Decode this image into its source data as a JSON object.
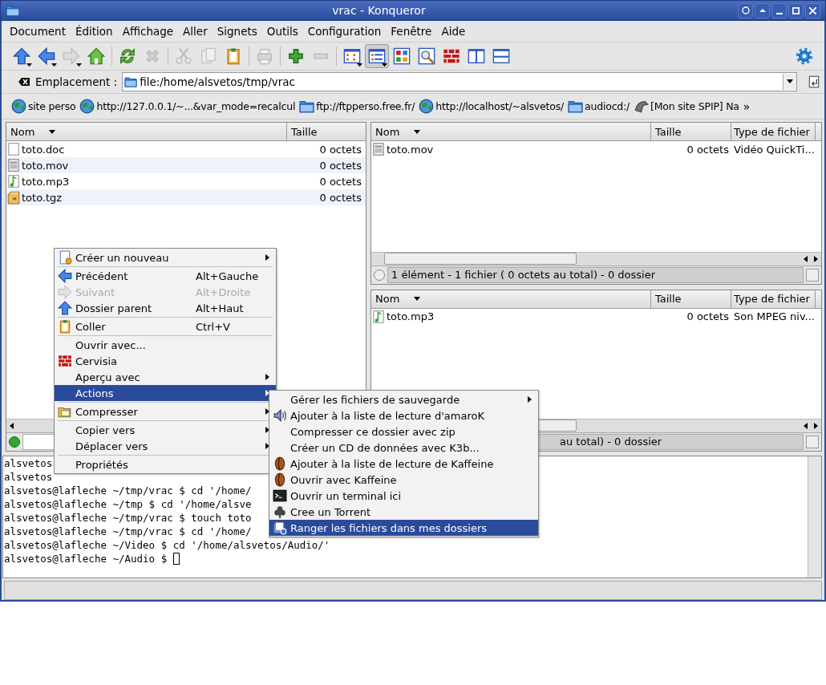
{
  "window": {
    "title": "vrac - Konqueror"
  },
  "menu_bar": [
    "Document",
    "Édition",
    "Affichage",
    "Aller",
    "Signets",
    "Outils",
    "Configuration",
    "Fenêtre",
    "Aide"
  ],
  "toolbar": [
    {
      "kind": "up",
      "disabled": false,
      "pressed": false,
      "dropdown": true
    },
    {
      "kind": "back",
      "disabled": false,
      "pressed": false,
      "dropdown": true
    },
    {
      "kind": "forward",
      "disabled": true,
      "pressed": false,
      "dropdown": true
    },
    {
      "kind": "home",
      "disabled": false,
      "pressed": false,
      "dropdown": false
    },
    {
      "kind": "separator"
    },
    {
      "kind": "reload",
      "disabled": false,
      "pressed": false,
      "dropdown": false
    },
    {
      "kind": "stop",
      "disabled": true,
      "pressed": false,
      "dropdown": false
    },
    {
      "kind": "separator"
    },
    {
      "kind": "cut",
      "disabled": true,
      "pressed": false,
      "dropdown": false
    },
    {
      "kind": "copy",
      "disabled": true,
      "pressed": false,
      "dropdown": false
    },
    {
      "kind": "paste",
      "disabled": false,
      "pressed": false,
      "dropdown": false
    },
    {
      "kind": "separator"
    },
    {
      "kind": "print",
      "disabled": true,
      "pressed": false,
      "dropdown": false
    },
    {
      "kind": "separator"
    },
    {
      "kind": "zoomin",
      "disabled": false,
      "pressed": false,
      "dropdown": false
    },
    {
      "kind": "zoomout",
      "disabled": true,
      "pressed": false,
      "dropdown": false
    },
    {
      "kind": "separator"
    },
    {
      "kind": "iconview",
      "disabled": false,
      "pressed": false,
      "dropdown": true
    },
    {
      "kind": "listview",
      "disabled": false,
      "pressed": true,
      "dropdown": true
    },
    {
      "kind": "tileview",
      "disabled": false,
      "pressed": false,
      "dropdown": false
    },
    {
      "kind": "preview",
      "disabled": false,
      "pressed": false,
      "dropdown": false
    },
    {
      "kind": "cervisia",
      "disabled": false,
      "pressed": false,
      "dropdown": false
    },
    {
      "kind": "splitv",
      "disabled": false,
      "pressed": false,
      "dropdown": false
    },
    {
      "kind": "splith",
      "disabled": false,
      "pressed": false,
      "dropdown": false
    },
    {
      "kind": "spacer"
    },
    {
      "kind": "gear",
      "disabled": false,
      "pressed": false,
      "dropdown": false
    }
  ],
  "location": {
    "label": "Emplacement :",
    "value": "file:/home/alsvetos/tmp/vrac"
  },
  "bookmarks": [
    {
      "kind": "web",
      "label": "site perso"
    },
    {
      "kind": "web",
      "label": "http://127.0.0.1/~...&var_mode=recalcul"
    },
    {
      "kind": "folder",
      "label": "ftp://ftpperso.free.fr/"
    },
    {
      "kind": "web",
      "label": "http://localhost/~alsvetos/"
    },
    {
      "kind": "folder",
      "label": "audiocd:/"
    },
    {
      "kind": "site",
      "label": "[Mon site SPIP] Na"
    }
  ],
  "bookmarks_more": "»",
  "left_view": {
    "active": true,
    "columns": [
      "Nom",
      "Taille"
    ],
    "rows": [
      {
        "kind": "document",
        "name": "toto.doc",
        "size": "0 octets"
      },
      {
        "kind": "video",
        "name": "toto.mov",
        "size": "0 octets"
      },
      {
        "kind": "audio",
        "name": "toto.mp3",
        "size": "0 octets"
      },
      {
        "kind": "archive",
        "name": "toto.tgz",
        "size": "0 octets"
      }
    ]
  },
  "right_views": [
    {
      "active": false,
      "columns": [
        "Nom",
        "Taille",
        "Type de fichier"
      ],
      "rows": [
        {
          "kind": "video",
          "name": "toto.mov",
          "size": "0 octets",
          "type": "Vidéo QuickTi..."
        }
      ],
      "status": "1 élément - 1 fichier ( 0 octets au total) - 0 dossier"
    },
    {
      "columns": [
        "Nom",
        "Taille",
        "Type de fichier"
      ],
      "rows": [
        {
          "kind": "audio",
          "name": "toto.mp3",
          "size": "0 octets",
          "type": "Son MPEG niv..."
        }
      ],
      "status": "au total) - 0 dossier"
    }
  ],
  "terminal": {
    "cursor": true,
    "lines": [
      "alsvetos",
      "alsvetos",
      "alsvetos@lafleche ~/tmp/vrac $ cd '/home/",
      "alsvetos@lafleche ~/tmp $ cd '/home/alsve",
      "alsvetos@lafleche ~/tmp/vrac $ touch toto",
      "alsvetos@lafleche ~/tmp/vrac $ cd '/home/",
      "alsvetos@lafleche ~/Video $ cd '/home/alsvetos/Audio/'",
      "alsvetos@lafleche ~/Audio $ "
    ]
  },
  "context_menu": [
    {
      "kind": "new",
      "label": "Créer un nouveau",
      "submenu": true,
      "disabled": false,
      "selected": false
    },
    {
      "kind": "separator"
    },
    {
      "kind": "back",
      "label": "Précédent",
      "shortcut": "Alt+Gauche",
      "submenu": false,
      "disabled": false,
      "selected": false
    },
    {
      "kind": "forward",
      "label": "Suivant",
      "shortcut": "Alt+Droite",
      "submenu": false,
      "disabled": true,
      "selected": false
    },
    {
      "kind": "up",
      "label": "Dossier parent",
      "shortcut": "Alt+Haut",
      "submenu": false,
      "disabled": false,
      "selected": false
    },
    {
      "kind": "separator"
    },
    {
      "kind": "paste",
      "label": "Coller",
      "shortcut": "Ctrl+V",
      "submenu": false,
      "disabled": false,
      "selected": false
    },
    {
      "kind": "separator"
    },
    {
      "kind": "plain",
      "label": "Ouvrir avec...",
      "submenu": false,
      "disabled": false,
      "selected": false
    },
    {
      "kind": "cervisia",
      "label": "Cervisia",
      "submenu": false,
      "disabled": false,
      "selected": false
    },
    {
      "kind": "plain",
      "label": "Aperçu avec",
      "submenu": true,
      "disabled": false,
      "selected": false
    },
    {
      "kind": "plain",
      "label": "Actions",
      "submenu": true,
      "disabled": false,
      "selected": true
    },
    {
      "kind": "separator"
    },
    {
      "kind": "compress",
      "label": "Compresser",
      "submenu": true,
      "disabled": false,
      "selected": false
    },
    {
      "kind": "separator"
    },
    {
      "kind": "plain",
      "label": "Copier vers",
      "submenu": true,
      "disabled": false,
      "selected": false
    },
    {
      "kind": "plain",
      "label": "Déplacer vers",
      "submenu": true,
      "disabled": false,
      "selected": false
    },
    {
      "kind": "separator"
    },
    {
      "kind": "plain",
      "label": "Propriétés",
      "submenu": false,
      "disabled": false,
      "selected": false
    }
  ],
  "actions_submenu": [
    {
      "kind": "plain",
      "label": "Gérer les fichiers de sauvegarde",
      "submenu": true,
      "selected": false
    },
    {
      "kind": "speaker",
      "label": "Ajouter à la liste de lecture d'amaroK",
      "submenu": false,
      "selected": false
    },
    {
      "kind": "plain",
      "label": "Compresser ce dossier avec zip",
      "submenu": false,
      "selected": false
    },
    {
      "kind": "plain",
      "label": "Créer un CD de données avec K3b...",
      "submenu": false,
      "selected": false
    },
    {
      "kind": "bean",
      "label": "Ajouter à la liste de lecture de Kaffeine",
      "submenu": false,
      "selected": false
    },
    {
      "kind": "bean",
      "label": "Ouvrir avec Kaffeine",
      "submenu": false,
      "selected": false
    },
    {
      "kind": "terminal",
      "label": "Ouvrir un terminal ici",
      "submenu": false,
      "selected": false
    },
    {
      "kind": "club",
      "label": "Cree un Torrent",
      "submenu": false,
      "selected": false
    },
    {
      "kind": "sort",
      "label": "Ranger les fichiers dans mes dossiers",
      "submenu": false,
      "selected": true
    }
  ]
}
